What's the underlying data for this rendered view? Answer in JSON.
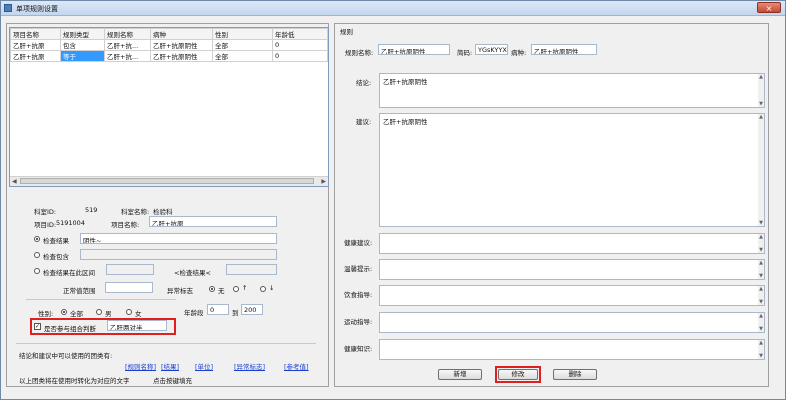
{
  "window": {
    "title": "单项规则设置",
    "close_label": "×"
  },
  "grid": {
    "columns": [
      "项目名称",
      "规则类型",
      "规则名称",
      "病种",
      "性别",
      "年龄低"
    ],
    "rows": [
      [
        "乙肝+抗原",
        "包含",
        "乙肝+抗...",
        "乙肝+抗原阴性",
        "全部",
        "0"
      ],
      [
        "乙肝+抗原",
        "等于",
        "乙肝+抗...",
        "乙肝+抗原阴性",
        "全部",
        "0"
      ]
    ]
  },
  "left_form": {
    "dept_id_label": "科室ID:",
    "dept_id_value": "519",
    "dept_name_label": "科室名称:",
    "dept_name_value": "检验科",
    "item_id_label": "项目ID:",
    "item_id_value": "5191004",
    "item_name_label": "项目名称:",
    "item_name_value": "乙肝+抗原",
    "check_result_label": "检查结果",
    "check_result_value": "阴性~",
    "check_contains_label": "检查包含",
    "check_range_label": "检查结果在此区间",
    "range_mid_label": "<检查结果<",
    "normal_value_label": "正常值范围",
    "abnormal_label": "异常标志",
    "abn_none": "无",
    "abn_up": "↑",
    "abn_down": "↓",
    "gender_label": "性别:",
    "gender_all": "全部",
    "gender_male": "男",
    "gender_female": "女",
    "age_label": "年龄段",
    "age_from": "0",
    "age_to_label": "到",
    "age_to": "200",
    "combine_label": "是否参与组合判断",
    "combine_value": "乙肝两对半",
    "hint_text": "结论和建议中可以使用的团类有:",
    "links": [
      "[规则名称]",
      "[结果]",
      "[单位]",
      "[异常标志]",
      "[参考值]"
    ],
    "footer_text": "以上团类将在使用时转化为对应的文字",
    "footer_tip": "点击按键填充"
  },
  "right_form": {
    "group_title": "规则",
    "rule_name_label": "规则名称:",
    "rule_name_value": "乙肝+抗原阴性",
    "short_code_label": "简码:",
    "short_code_value": "YGsKYYX",
    "disease_label": "病种:",
    "disease_value": "乙肝+抗原阴性",
    "conclusion_label": "结论:",
    "conclusion_value": "乙肝+抗原阴性",
    "advice_label": "建议:",
    "advice_value": "乙肝+抗原阴性",
    "health_advice_label": "健康建议:",
    "warm_tip_label": "温馨提示:",
    "diet_label": "饮食指导:",
    "exercise_label": "运动指导:",
    "health_knowledge_label": "健康知识:",
    "btn_new": "新增",
    "btn_modify": "修改",
    "btn_delete": "删除"
  }
}
